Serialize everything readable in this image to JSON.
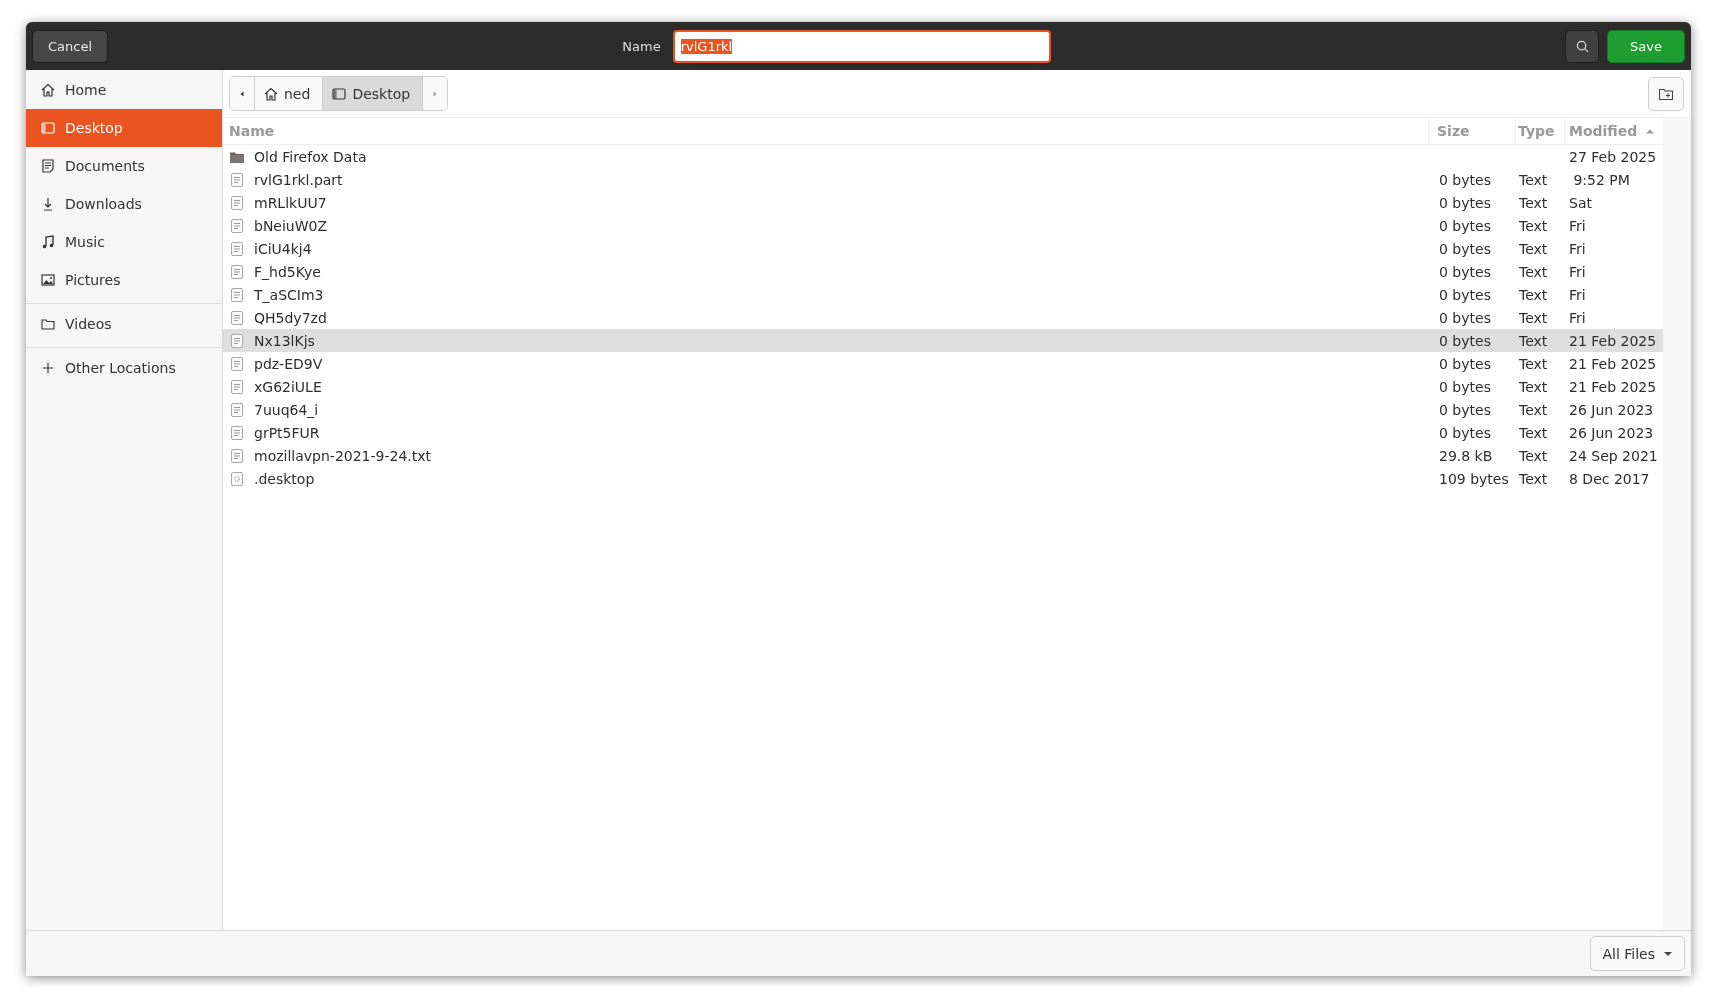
{
  "header": {
    "cancel": "Cancel",
    "name_label": "Name",
    "name_value": "rvlG1rkl",
    "name_selected": true,
    "save": "Save"
  },
  "sidebar": {
    "sections": [
      [
        {
          "label": "Home",
          "kind": "home",
          "selected": false
        },
        {
          "label": "Desktop",
          "kind": "desktop",
          "selected": true
        },
        {
          "label": "Documents",
          "kind": "documents",
          "selected": false
        },
        {
          "label": "Downloads",
          "kind": "downloads",
          "selected": false
        },
        {
          "label": "Music",
          "kind": "music",
          "selected": false
        },
        {
          "label": "Pictures",
          "kind": "pictures",
          "selected": false
        }
      ],
      [
        {
          "label": "Videos",
          "kind": "folder",
          "selected": false
        }
      ],
      [
        {
          "label": "Other Locations",
          "kind": "add",
          "selected": false
        }
      ]
    ]
  },
  "path_bar": [
    {
      "label": "ned",
      "kind": "home",
      "selected": false
    },
    {
      "label": "Desktop",
      "kind": "desktop",
      "selected": true
    }
  ],
  "table": {
    "columns": [
      {
        "label": "Name",
        "sorted": false
      },
      {
        "label": "Size",
        "sorted": false
      },
      {
        "label": "Type",
        "sorted": false
      },
      {
        "label": "Modified",
        "sorted": true
      }
    ],
    "rows": [
      {
        "kind": "folder",
        "name": "Old Firefox Data",
        "size": "",
        "type": "",
        "modified": "27 Feb 2025",
        "selected": false
      },
      {
        "kind": "text",
        "name": "rvlG1rkl.part",
        "size": "0 bytes",
        "type": "Text",
        "modified": " 9:52 PM",
        "selected": false
      },
      {
        "kind": "text",
        "name": "mRLlkUU7",
        "size": "0 bytes",
        "type": "Text",
        "modified": "Sat",
        "selected": false
      },
      {
        "kind": "text",
        "name": "bNeiuW0Z",
        "size": "0 bytes",
        "type": "Text",
        "modified": "Fri",
        "selected": false
      },
      {
        "kind": "text",
        "name": "iCiU4kj4",
        "size": "0 bytes",
        "type": "Text",
        "modified": "Fri",
        "selected": false
      },
      {
        "kind": "text",
        "name": "F_hd5Kye",
        "size": "0 bytes",
        "type": "Text",
        "modified": "Fri",
        "selected": false
      },
      {
        "kind": "text",
        "name": "T_aSCIm3",
        "size": "0 bytes",
        "type": "Text",
        "modified": "Fri",
        "selected": false
      },
      {
        "kind": "text",
        "name": "QH5dy7zd",
        "size": "0 bytes",
        "type": "Text",
        "modified": "Fri",
        "selected": false
      },
      {
        "kind": "text",
        "name": "Nx13lKjs",
        "size": "0 bytes",
        "type": "Text",
        "modified": "21 Feb 2025",
        "selected": true
      },
      {
        "kind": "text",
        "name": "pdz-ED9V",
        "size": "0 bytes",
        "type": "Text",
        "modified": "21 Feb 2025",
        "selected": false
      },
      {
        "kind": "text",
        "name": "xG62iULE",
        "size": "0 bytes",
        "type": "Text",
        "modified": "21 Feb 2025",
        "selected": false
      },
      {
        "kind": "text",
        "name": "7uuq64_i",
        "size": "0 bytes",
        "type": "Text",
        "modified": "26 Jun 2023",
        "selected": false
      },
      {
        "kind": "text",
        "name": "grPt5FUR",
        "size": "0 bytes",
        "type": "Text",
        "modified": "26 Jun 2023",
        "selected": false
      },
      {
        "kind": "text",
        "name": "mozillavpn-2021-9-24.txt",
        "size": "29.8 kB",
        "type": "Text",
        "modified": "24 Sep 2021",
        "selected": false
      },
      {
        "kind": "config",
        "name": ".desktop",
        "size": "109 bytes",
        "type": "Text",
        "modified": "8 Dec 2017",
        "selected": false
      }
    ]
  },
  "filter": "All Files"
}
